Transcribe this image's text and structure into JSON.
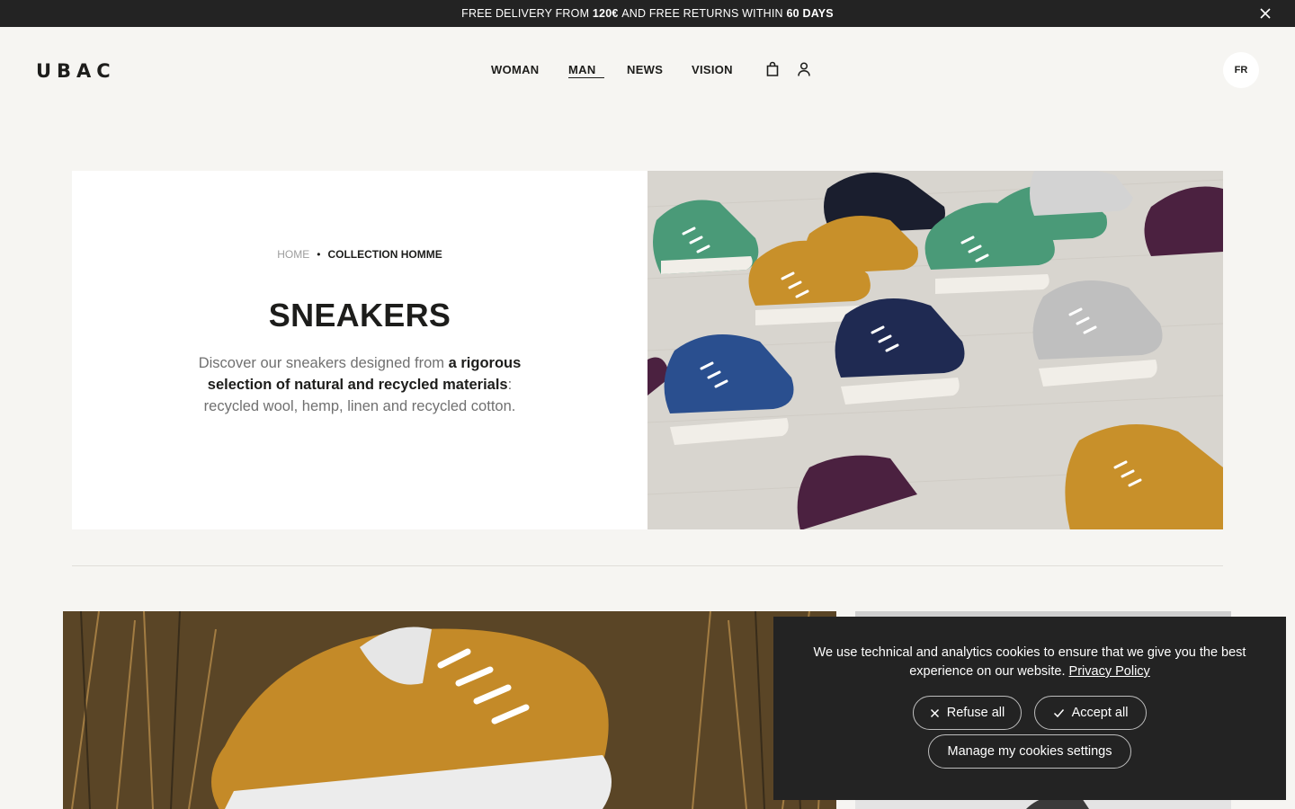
{
  "announcement": {
    "prefix": "FREE DELIVERY FROM ",
    "amount": "120€",
    "middle": " AND FREE RETURNS WITHIN ",
    "days": "60 DAYS"
  },
  "header": {
    "logo": "UBAC",
    "nav": [
      "WOMAN",
      "MAN",
      "NEWS",
      "VISION"
    ],
    "active_nav": "MAN",
    "language": "FR"
  },
  "hero": {
    "breadcrumb_home": "HOME",
    "breadcrumb_current": "COLLECTION HOMME",
    "title": "SNEAKERS",
    "desc_lead": "Discover our sneakers designed from ",
    "desc_bold": "a rigorous selection of natural and recycled materials",
    "desc_tail": ": recycled wool, hemp, linen and recycled cotton."
  },
  "cookie": {
    "text": "We use technical and analytics cookies to ensure that we give you the best experience on our website.",
    "link": "Privacy Policy",
    "refuse": "Refuse all",
    "accept": "Accept all",
    "manage": "Manage my cookies settings"
  },
  "colors": {
    "background": "#f6f5f2",
    "dark": "#232323",
    "text": "#1d1d1b",
    "muted": "#707070"
  }
}
